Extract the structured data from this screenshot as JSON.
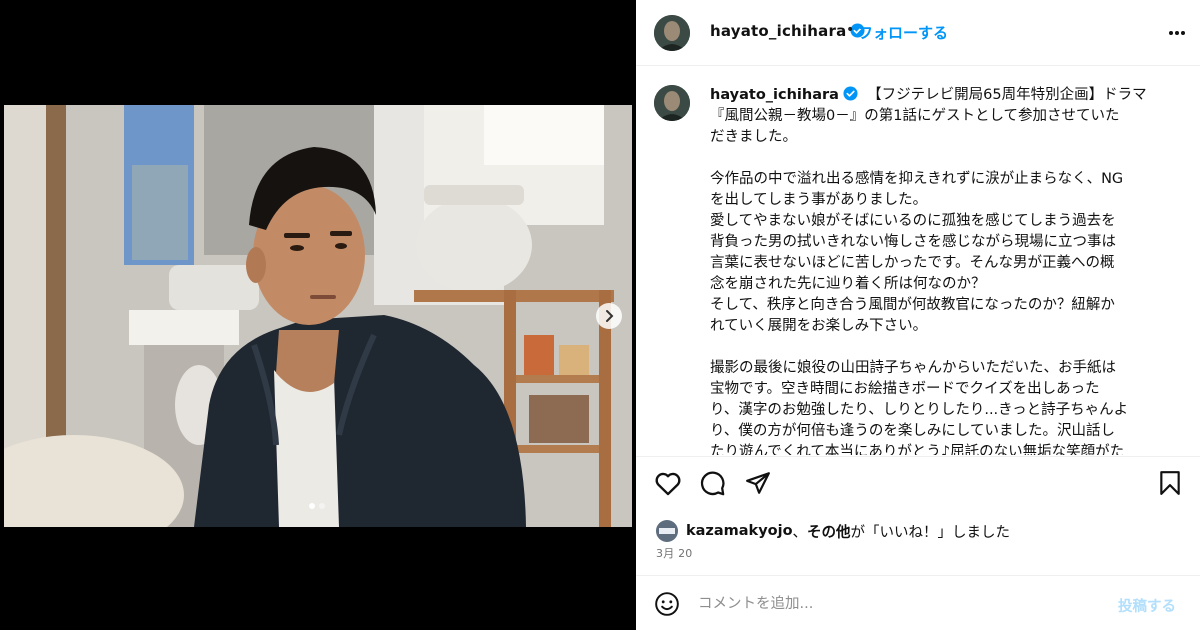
{
  "post": {
    "username": "hayato_ichihara",
    "separator": "•",
    "follow_label": "フォローする",
    "caption_lines": [
      "【フジテレビ開局65周年特別企画】ドラマ",
      "『風間公親－教場0－』の第1話にゲストとして参加させていた",
      "だきました。",
      "",
      "今作品の中で溢れ出る感情を抑えきれずに涙が止まらなく、NG",
      "を出してしまう事がありました。",
      "愛してやまない娘がそばにいるのに孤独を感じてしまう過去を",
      "背負った男の拭いきれない悔しさを感じながら現場に立つ事は",
      "言葉に表せないほどに苦しかったです。そんな男が正義への概",
      "念を崩された先に辿り着く所は何なのか？",
      "そして、秩序と向き合う風間が何故教官になったのか？紐解か",
      "れていく展開をお楽しみ下さい。",
      "",
      "撮影の最後に娘役の山田詩子ちゃんからいただいた、お手紙は",
      "宝物です。空き時間にお絵描きボードでクイズを出しあった",
      "り、漢字のお勉強したり、しりとりしたり...きっと詩子ちゃんよ",
      "り、僕の方が何倍も逢うのを楽しみにしていました。沢山話し",
      "たり遊んでくれて本当にありがとう♪屈託のない無垢な笑顔がた"
    ],
    "likes": {
      "user": "kazamakyojo",
      "middle": "、",
      "others": "その他",
      "suffix": "が「いいね！」しました"
    },
    "date": "3月 20"
  },
  "comment": {
    "placeholder": "コメントを追加...",
    "post_label": "投稿する"
  },
  "carousel": {
    "current": 1,
    "total": 2
  },
  "colors": {
    "accent": "#0095f6",
    "verified": "#0095f6",
    "post_disabled": "#b2dffc",
    "muted": "#737373"
  },
  "icons": [
    "verified-badge-icon",
    "more-options-icon",
    "heart-icon",
    "comment-icon",
    "share-icon",
    "bookmark-icon",
    "emoji-icon",
    "chevron-right-icon"
  ]
}
